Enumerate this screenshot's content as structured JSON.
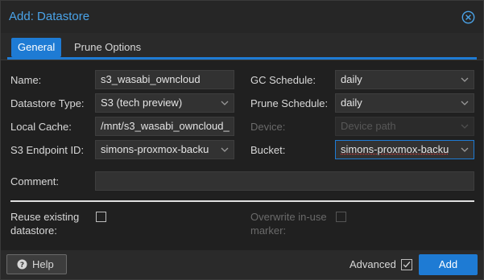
{
  "dialog": {
    "title": "Add: Datastore"
  },
  "tabs": [
    {
      "label": "General"
    },
    {
      "label": "Prune Options"
    }
  ],
  "form": {
    "name": {
      "label": "Name:",
      "value": "s3_wasabi_owncloud"
    },
    "datastore_type": {
      "label": "Datastore Type:",
      "value": "S3 (tech preview)"
    },
    "local_cache": {
      "label": "Local Cache:",
      "value": "/mnt/s3_wasabi_owncloud_"
    },
    "s3_endpoint_id": {
      "label": "S3 Endpoint ID:",
      "value": "simons-proxmox-backu"
    },
    "gc_schedule": {
      "label": "GC Schedule:",
      "value": "daily"
    },
    "prune_schedule": {
      "label": "Prune Schedule:",
      "value": "daily"
    },
    "device": {
      "label": "Device:",
      "placeholder": "Device path"
    },
    "bucket": {
      "label": "Bucket:",
      "value": "simons-proxmox-backu"
    },
    "comment": {
      "label": "Comment:",
      "value": ""
    },
    "reuse_existing": {
      "label_line1": "Reuse existing",
      "label_line2": "datastore:",
      "checked": false
    },
    "overwrite_in_use": {
      "label_line1": "Overwrite in-use",
      "label_line2": "marker:",
      "checked": false,
      "disabled": true
    }
  },
  "footer": {
    "help_label": "Help",
    "advanced_label": "Advanced",
    "advanced_checked": true,
    "add_label": "Add"
  },
  "colors": {
    "accent": "#1e7bd4",
    "title": "#4aa3e8",
    "background": "#262626"
  }
}
